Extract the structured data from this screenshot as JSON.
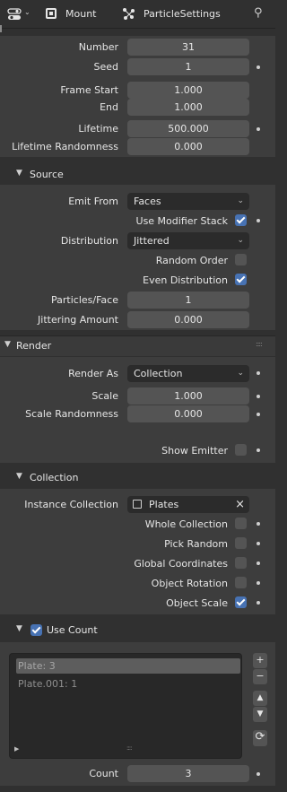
{
  "header": {
    "object_name": "Mount",
    "settings_name": "ParticleSettings"
  },
  "emission": {
    "number": {
      "label": "Number",
      "value": "31"
    },
    "seed": {
      "label": "Seed",
      "value": "1"
    },
    "frame_start": {
      "label": "Frame Start",
      "value": "1.000"
    },
    "end": {
      "label": "End",
      "value": "1.000"
    },
    "lifetime": {
      "label": "Lifetime",
      "value": "500.000"
    },
    "lifetime_randomness": {
      "label": "Lifetime Randomness",
      "value": "0.000"
    }
  },
  "source": {
    "title": "Source",
    "emit_from": {
      "label": "Emit From",
      "value": "Faces"
    },
    "use_modifier_stack": {
      "label": "Use Modifier Stack",
      "checked": true
    },
    "distribution": {
      "label": "Distribution",
      "value": "Jittered"
    },
    "random_order": {
      "label": "Random Order",
      "checked": false
    },
    "even_distribution": {
      "label": "Even Distribution",
      "checked": true
    },
    "particles_face": {
      "label": "Particles/Face",
      "value": "1"
    },
    "jittering_amount": {
      "label": "Jittering Amount",
      "value": "0.000"
    }
  },
  "render": {
    "title": "Render",
    "render_as": {
      "label": "Render As",
      "value": "Collection"
    },
    "scale": {
      "label": "Scale",
      "value": "1.000"
    },
    "scale_randomness": {
      "label": "Scale Randomness",
      "value": "0.000"
    },
    "show_emitter": {
      "label": "Show Emitter",
      "checked": false
    }
  },
  "collection": {
    "title": "Collection",
    "instance_collection": {
      "label": "Instance Collection",
      "value": "Plates"
    },
    "whole_collection": {
      "label": "Whole Collection",
      "checked": false
    },
    "pick_random": {
      "label": "Pick Random",
      "checked": false
    },
    "global_coordinates": {
      "label": "Global Coordinates",
      "checked": false
    },
    "object_rotation": {
      "label": "Object Rotation",
      "checked": false
    },
    "object_scale": {
      "label": "Object Scale",
      "checked": true
    }
  },
  "use_count": {
    "title": "Use Count",
    "enabled": true,
    "items": [
      "Plate: 3",
      "Plate.001: 1"
    ],
    "count": {
      "label": "Count",
      "value": "3"
    }
  },
  "icons": {
    "add": "+",
    "remove": "−",
    "up": "▲",
    "down": "▼",
    "refresh": "⟳"
  }
}
